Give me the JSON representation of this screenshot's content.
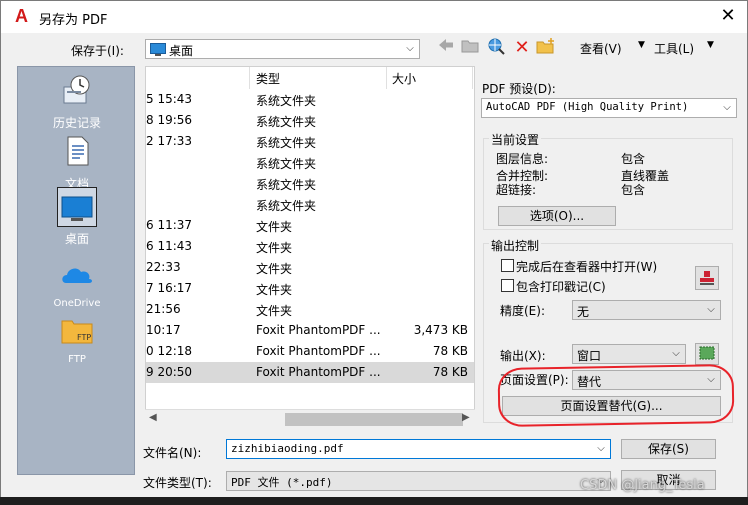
{
  "window": {
    "title": "另存为 PDF",
    "close_glyph": "✕"
  },
  "toolbar": {
    "save_in_label": "保存于(I):",
    "location": "桌面",
    "view_label": "查看(V)",
    "tools_label": "工具(L)"
  },
  "places": [
    {
      "label": "历史记录",
      "icon": "history-icon"
    },
    {
      "label": "文档",
      "icon": "documents-icon"
    },
    {
      "label": "桌面",
      "icon": "desktop-icon"
    },
    {
      "label": "OneDrive",
      "icon": "onedrive-icon"
    },
    {
      "label": "FTP",
      "icon": "ftp-folder-icon"
    }
  ],
  "file_list": {
    "columns": {
      "type": "类型",
      "size": "大小"
    },
    "rows": [
      {
        "date": "5 15:43",
        "type": "系统文件夹",
        "size": ""
      },
      {
        "date": "8 19:56",
        "type": "系统文件夹",
        "size": ""
      },
      {
        "date": "2 17:33",
        "type": "系统文件夹",
        "size": ""
      },
      {
        "date": "",
        "type": "系统文件夹",
        "size": ""
      },
      {
        "date": "",
        "type": "系统文件夹",
        "size": ""
      },
      {
        "date": "",
        "type": "系统文件夹",
        "size": ""
      },
      {
        "date": "6 11:37",
        "type": "文件夹",
        "size": ""
      },
      {
        "date": "6 11:43",
        "type": "文件夹",
        "size": ""
      },
      {
        "date": " 22:33",
        "type": "文件夹",
        "size": ""
      },
      {
        "date": "7 16:17",
        "type": "文件夹",
        "size": ""
      },
      {
        "date": " 21:56",
        "type": "文件夹",
        "size": ""
      },
      {
        "date": " 10:17",
        "type": "Foxit PhantomPDF ...",
        "size": "3,473 KB"
      },
      {
        "date": "0 12:18",
        "type": "Foxit PhantomPDF ...",
        "size": "78 KB"
      },
      {
        "date": "9 20:50",
        "type": "Foxit PhantomPDF ...",
        "size": "78 KB"
      }
    ]
  },
  "filename": {
    "label": "文件名(N):",
    "value": "zizhibiaoding.pdf"
  },
  "filetype": {
    "label": "文件类型(T):",
    "value": "PDF 文件 (*.pdf)"
  },
  "buttons": {
    "save": "保存(S)",
    "cancel": "取消"
  },
  "pdf": {
    "preset_label": "PDF 预设(D):",
    "preset_value": "AutoCAD PDF (High Quality Print)",
    "current_settings_title": "当前设置",
    "settings": [
      {
        "name": "图层信息:",
        "value": "包含"
      },
      {
        "name": "合并控制:",
        "value": "直线覆盖"
      },
      {
        "name": "超链接:",
        "value": "包含"
      }
    ],
    "options_button": "选项(O)...",
    "output_control_title": "输出控制",
    "open_in_viewer": "完成后在查看器中打开(W)",
    "include_stamp": "包含打印戳记(C)",
    "precision_label": "精度(E):",
    "precision_value": "无",
    "output_label": "输出(X):",
    "output_value": "窗口",
    "page_setup_label": "页面设置(P):",
    "page_setup_value": "替代",
    "page_setup_override_button": "页面设置替代(G)..."
  },
  "watermark": "CSDN @Jiang_Tesla",
  "colors": {
    "annotation": "#e8232a",
    "places_bg": "#a8b4c4",
    "selected_row": "#d9d9d9"
  }
}
